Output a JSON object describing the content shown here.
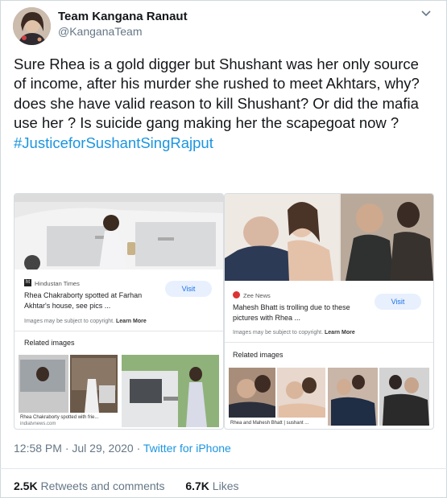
{
  "tweet": {
    "display_name": "Team Kangana Ranaut",
    "handle": "@KanganaTeam",
    "text": "Sure Rhea is a gold digger but Shushant was her only source of income, after his murder she rushed to meet Akhtars, why? does she have valid reason to kill Shushant? Or did the mafia use her ? Is suicide gang making her the scapegoat now ? ",
    "hashtag": "#JusticeforSushantSingRajput",
    "time": "12:58 PM",
    "date": "Jul 29, 2020",
    "separator": "·",
    "app": "Twitter for iPhone",
    "retweets_count": "2.5K",
    "retweets_label": "Retweets and comments",
    "likes_count": "6.7K",
    "likes_label": "Likes"
  },
  "cards": [
    {
      "source": "Hindustan Times",
      "caption": "Rhea Chakraborty spotted at Farhan Akhtar's house, see pics ...",
      "visit_label": "Visit",
      "copyright": "Images may be subject to copyright.",
      "learn_more": "Learn More",
      "related_label": "Related images",
      "thumb_caption": "Rhea Chakraborty spotted with frie...",
      "thumb_source": "indiatvnews.com"
    },
    {
      "source": "Zee News",
      "caption": "Mahesh Bhatt is trolling due to these pictures with Rhea ...",
      "visit_label": "Visit",
      "copyright": "Images may be subject to copyright.",
      "learn_more": "Learn More",
      "related_label": "Related images",
      "thumb_caption": "Rhea and Mahesh Bhatt | sushant ..."
    }
  ],
  "icons": {
    "caret": "chevron-down-icon",
    "avatar": "profile-photo"
  },
  "colors": {
    "link": "#1b95e0",
    "secondary_text": "#657786",
    "visit_bg": "#e8f0fe",
    "visit_text": "#1a73e8"
  }
}
